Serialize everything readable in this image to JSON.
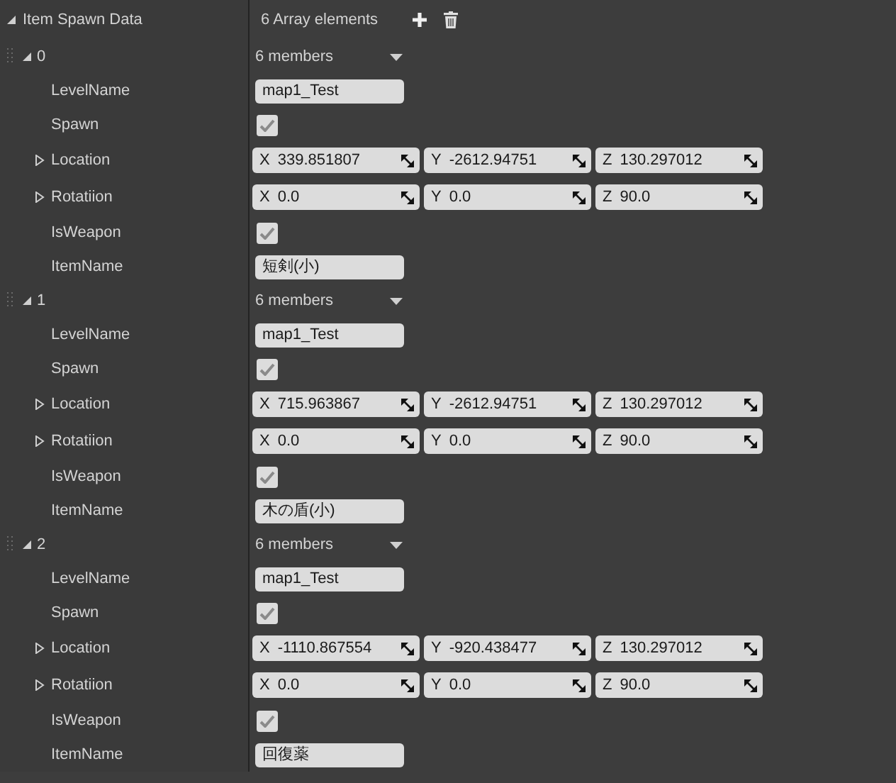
{
  "property": {
    "label": "Item Spawn Data",
    "expanded": true,
    "count": "6 Array elements"
  },
  "elements": [
    {
      "index": "0",
      "expanded": true,
      "members": "6 members",
      "fields": [
        {
          "kind": "text",
          "label": "LevelName",
          "value": "map1_Test"
        },
        {
          "kind": "checkbox",
          "label": "Spawn",
          "checked": true
        },
        {
          "kind": "vector",
          "label": "Location",
          "expanded": false,
          "components": [
            {
              "axis": "X",
              "value": "339.851807"
            },
            {
              "axis": "Y",
              "value": "-2612.94751"
            },
            {
              "axis": "Z",
              "value": "130.297012"
            }
          ]
        },
        {
          "kind": "vector",
          "label": "Rotatiion",
          "expanded": false,
          "components": [
            {
              "axis": "X",
              "value": "0.0"
            },
            {
              "axis": "Y",
              "value": "0.0"
            },
            {
              "axis": "Z",
              "value": "90.0"
            }
          ]
        },
        {
          "kind": "checkbox",
          "label": "IsWeapon",
          "checked": true
        },
        {
          "kind": "text",
          "label": "ItemName",
          "value": "短剣(小)"
        }
      ]
    },
    {
      "index": "1",
      "expanded": true,
      "members": "6 members",
      "fields": [
        {
          "kind": "text",
          "label": "LevelName",
          "value": "map1_Test"
        },
        {
          "kind": "checkbox",
          "label": "Spawn",
          "checked": true
        },
        {
          "kind": "vector",
          "label": "Location",
          "expanded": false,
          "components": [
            {
              "axis": "X",
              "value": "715.963867"
            },
            {
              "axis": "Y",
              "value": "-2612.94751"
            },
            {
              "axis": "Z",
              "value": "130.297012"
            }
          ]
        },
        {
          "kind": "vector",
          "label": "Rotatiion",
          "expanded": false,
          "components": [
            {
              "axis": "X",
              "value": "0.0"
            },
            {
              "axis": "Y",
              "value": "0.0"
            },
            {
              "axis": "Z",
              "value": "90.0"
            }
          ]
        },
        {
          "kind": "checkbox",
          "label": "IsWeapon",
          "checked": true
        },
        {
          "kind": "text",
          "label": "ItemName",
          "value": "木の盾(小)"
        }
      ]
    },
    {
      "index": "2",
      "expanded": true,
      "members": "6 members",
      "fields": [
        {
          "kind": "text",
          "label": "LevelName",
          "value": "map1_Test"
        },
        {
          "kind": "checkbox",
          "label": "Spawn",
          "checked": true
        },
        {
          "kind": "vector",
          "label": "Location",
          "expanded": false,
          "components": [
            {
              "axis": "X",
              "value": "-1110.867554"
            },
            {
              "axis": "Y",
              "value": "-920.438477"
            },
            {
              "axis": "Z",
              "value": "130.297012"
            }
          ]
        },
        {
          "kind": "vector",
          "label": "Rotatiion",
          "expanded": false,
          "components": [
            {
              "axis": "X",
              "value": "0.0"
            },
            {
              "axis": "Y",
              "value": "0.0"
            },
            {
              "axis": "Z",
              "value": "90.0"
            }
          ]
        },
        {
          "kind": "checkbox",
          "label": "IsWeapon",
          "checked": true
        },
        {
          "kind": "text",
          "label": "ItemName",
          "value": "回復薬"
        }
      ]
    }
  ]
}
